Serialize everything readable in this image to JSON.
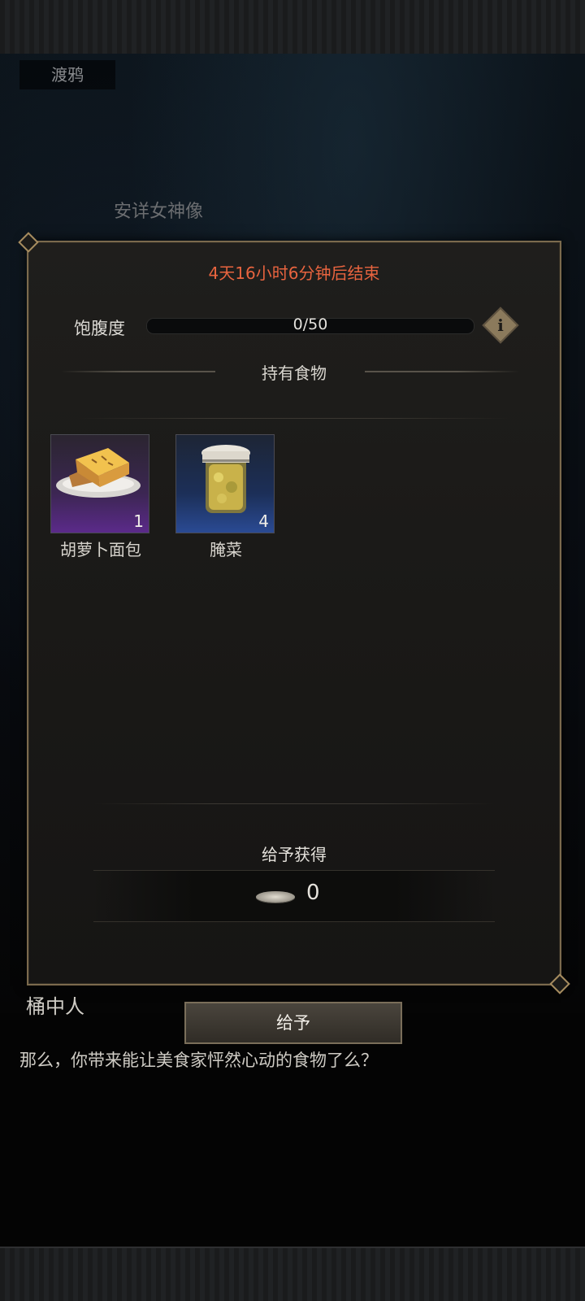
{
  "background": {
    "location_tag": "渡鸦",
    "statue_label": "安详女神像"
  },
  "panel": {
    "timer_text": "4天16小时6分钟后结束",
    "satiety": {
      "label": "饱腹度",
      "value_text": "0/50",
      "current": 0,
      "max": 50
    },
    "info_icon": "info-diamond-icon",
    "food_section_title": "持有食物",
    "foods": [
      {
        "name": "胡萝卜面包",
        "count": "1",
        "rarity": "purple",
        "icon": "carrot-bread-icon"
      },
      {
        "name": "腌菜",
        "count": "4",
        "rarity": "blue",
        "icon": "pickle-jar-icon"
      }
    ],
    "reward": {
      "title": "给予获得",
      "value": "0",
      "icon": "silver-coin-icon"
    }
  },
  "dialogue": {
    "speaker": "桶中人",
    "give_button_label": "给予",
    "text": "那么，你带来能让美食家怦然心动的食物了么？"
  },
  "colors": {
    "timer": "#e8643f",
    "panel_border": "#7b6a4d",
    "rarity_purple": "#5b2a8a",
    "rarity_blue": "#2a4a93"
  }
}
